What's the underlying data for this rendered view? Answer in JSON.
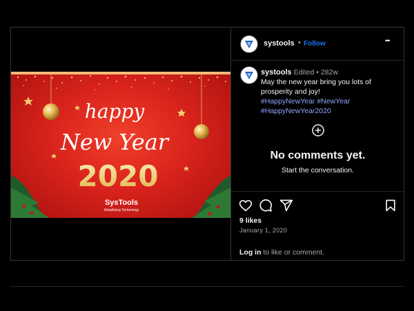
{
  "post": {
    "username": "systools",
    "follow_label": "Follow",
    "more_label": "•••",
    "caption": {
      "username": "systools",
      "edited": "Edited",
      "age": "282w",
      "text": "May the new year bring you lots of prosperity and joy!",
      "hashtags_line1": "#HappyNewYear #NewYear",
      "hashtags_line2": "#HappyNewYear2020"
    },
    "empty": {
      "title": "No comments yet.",
      "subtitle": "Start the conversation."
    },
    "likes": "9 likes",
    "date": "January 1, 2020",
    "login": {
      "link": "Log in",
      "rest": "to like or comment."
    }
  },
  "image": {
    "happy": "happy",
    "new_year": "New Year",
    "year": "2020",
    "brand": "SysTools",
    "tagline": "Simplifying Technology"
  },
  "icons": [
    "heart-icon",
    "comment-icon",
    "share-icon",
    "bookmark-icon",
    "plus-circle-icon",
    "more-icon"
  ],
  "colors": {
    "background": "#000000",
    "follow": "#1877f2",
    "hashtag": "#8fa6ff",
    "card_red": "#d9231c",
    "gold": "#e8c46a"
  }
}
